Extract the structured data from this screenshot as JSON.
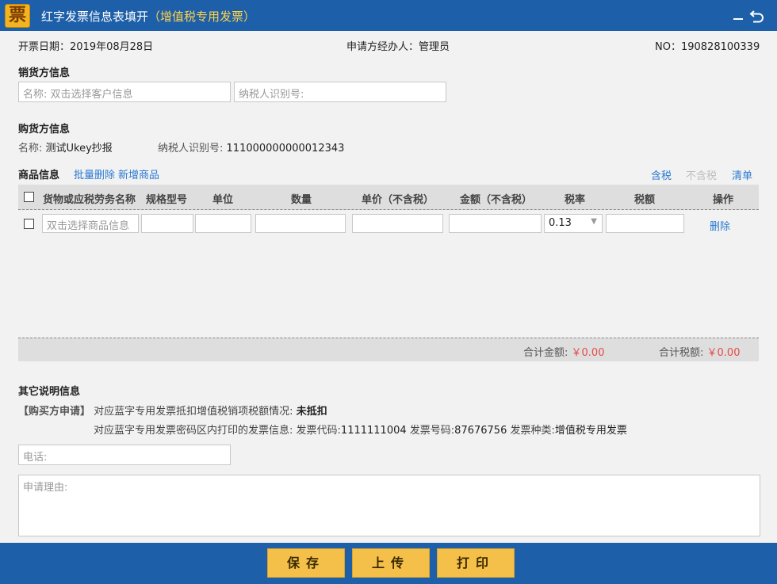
{
  "window": {
    "logo_char": "票",
    "title": "红字发票信息表填开",
    "title_accent": "（增值税专用发票）",
    "min_icon": "minimize-icon",
    "back_icon": "back-icon"
  },
  "header": {
    "date_label": "开票日期：",
    "date_value": "2019年08月28日",
    "handler_label": "申请方经办人：",
    "handler_value": "管理员",
    "no_label": "NO：",
    "no_value": "190828100339"
  },
  "seller": {
    "section_title": "销货方信息",
    "name_placeholder": "名称: 双击选择客户信息",
    "tax_id_placeholder": "纳税人识别号:"
  },
  "buyer": {
    "section_title": "购货方信息",
    "name_label": "名称:",
    "name_value": "测试Ukey抄报",
    "tax_id_label": "纳税人识别号:",
    "tax_id_value": "111000000000012343"
  },
  "goods": {
    "section_title": "商品信息",
    "batch_delete": "批量删除",
    "add_item": "新增商品",
    "with_tax": "含税",
    "without_tax": "不含税",
    "list": "清单",
    "columns": [
      "货物或应税劳务名称",
      "规格型号",
      "单位",
      "数量",
      "单价（不含税）",
      "金额（不含税）",
      "税率",
      "税额",
      "操作"
    ],
    "row": {
      "name_placeholder": "双击选择商品信息",
      "tax_rate": "0.13",
      "delete": "删除"
    },
    "total_amount_label": "合计金额:",
    "total_amount_value": "￥0.00",
    "total_tax_label": "合计税额:",
    "total_tax_value": "￥0.00"
  },
  "other": {
    "section_title": "其它说明信息",
    "applicant_tag": "【购买方申请】",
    "line1_text": "对应蓝字专用发票抵扣增值税销项税额情况:",
    "line1_value": "未抵扣",
    "line2_text": "对应蓝字专用发票密码区内打印的发票信息:",
    "invoice_code_label": "发票代码:",
    "invoice_code_value": "1111111004",
    "invoice_no_label": "发票号码:",
    "invoice_no_value": "87676756",
    "invoice_type_label": "发票种类:",
    "invoice_type_value": "增值税专用发票",
    "phone_placeholder": "电话:",
    "reason_placeholder": "申请理由:"
  },
  "footer": {
    "save": "保存",
    "upload": "上传",
    "print": "打印"
  },
  "colors": {
    "titlebar": "#1d5fa8",
    "accent_yellow": "#ffd24a",
    "button_yellow": "#f5c04a",
    "link_blue": "#2a7ad2",
    "amount_red": "#e64a4a"
  }
}
